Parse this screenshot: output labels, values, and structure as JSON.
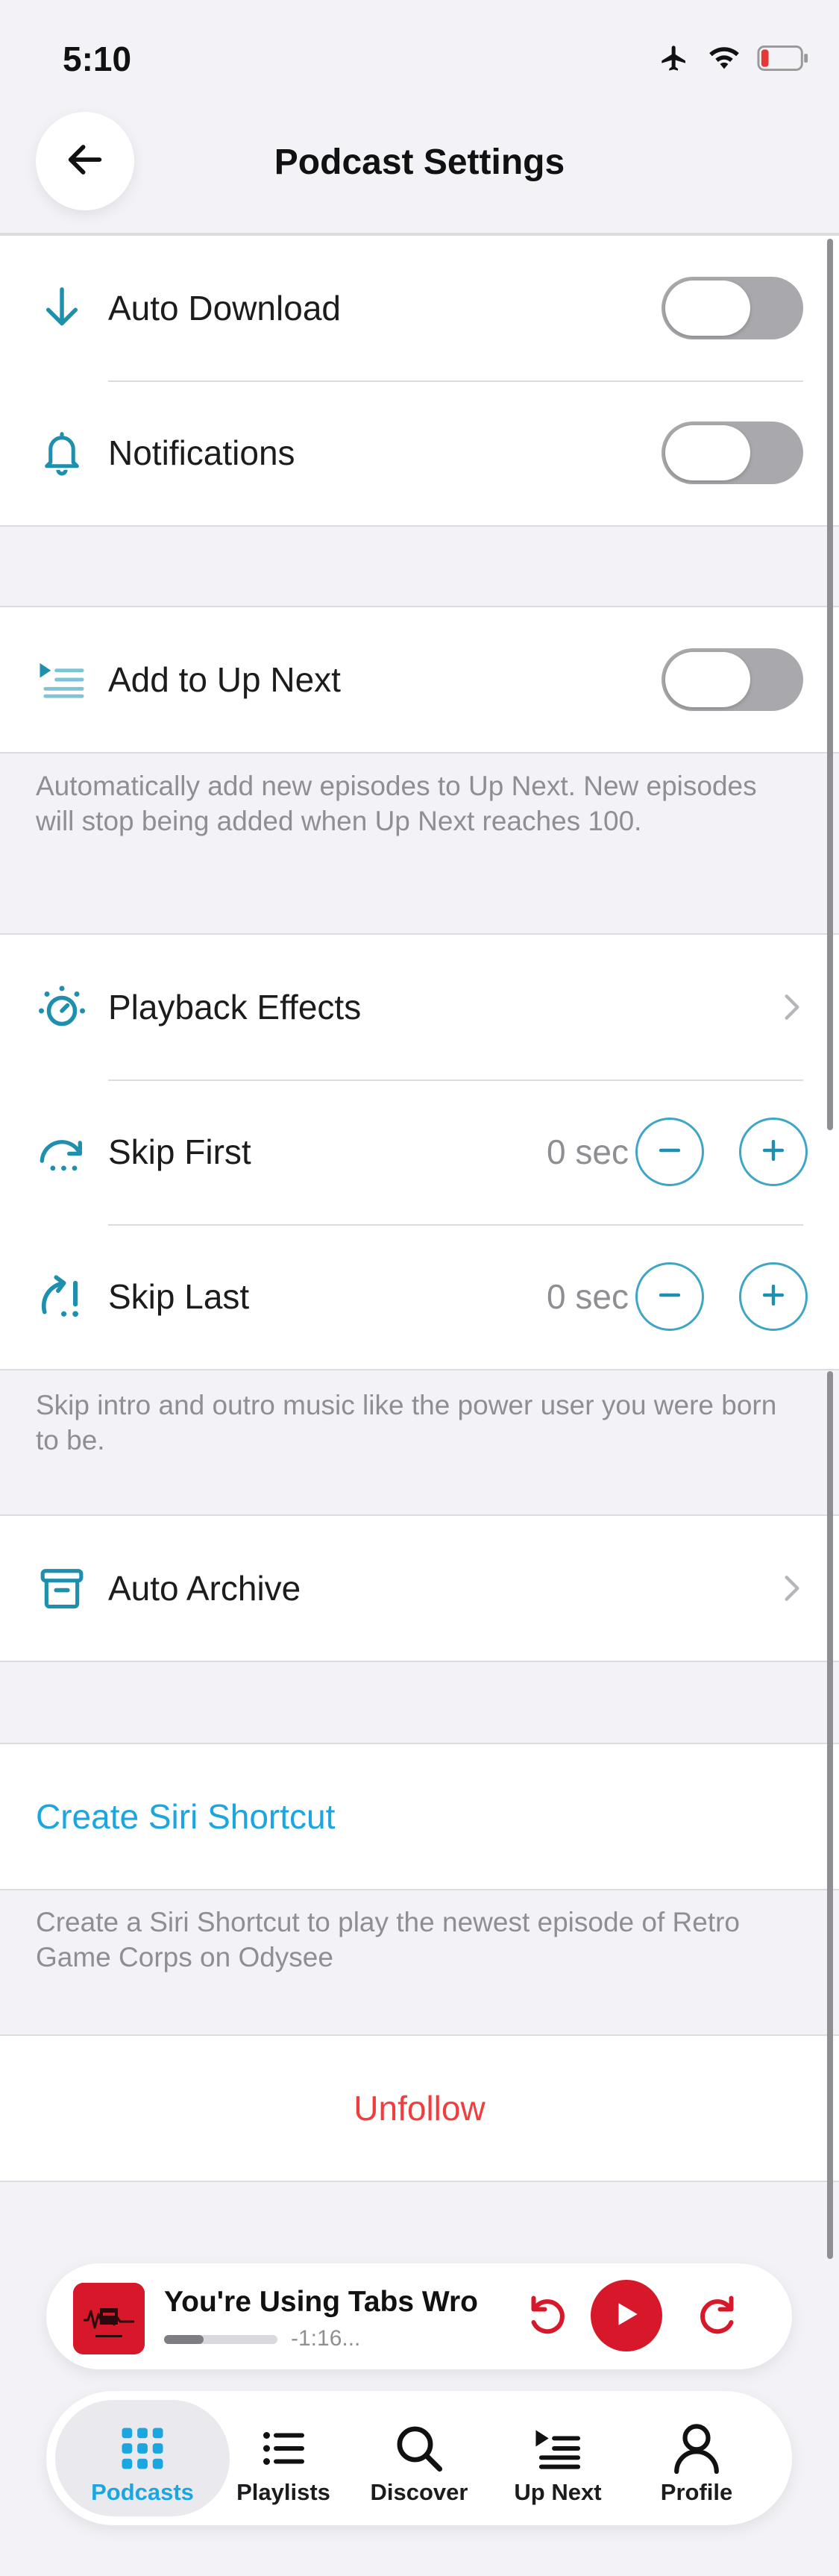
{
  "status_bar": {
    "time": "5:10"
  },
  "nav": {
    "title": "Podcast Settings"
  },
  "settings": {
    "auto_download": {
      "label": "Auto Download",
      "enabled": false
    },
    "notifications": {
      "label": "Notifications",
      "enabled": false
    },
    "add_to_up_next": {
      "label": "Add to Up Next",
      "enabled": false
    },
    "up_next_footer": "Automatically add new episodes to Up Next. New episodes will stop being added when Up Next reaches 100.",
    "playback_effects": {
      "label": "Playback Effects"
    },
    "skip_first": {
      "label": "Skip First",
      "value": "0 sec"
    },
    "skip_last": {
      "label": "Skip Last",
      "value": "0 sec"
    },
    "skip_footer": "Skip intro and outro music like the power user you were born to be.",
    "auto_archive": {
      "label": "Auto Archive"
    },
    "siri_shortcut": {
      "label": "Create Siri Shortcut"
    },
    "siri_footer": "Create a Siri Shortcut to play the newest episode of Retro Game Corps on Odysee",
    "unfollow": {
      "label": "Unfollow"
    }
  },
  "mini_player": {
    "title": "You're Using Tabs Wrong",
    "time_remaining": "-1:16...",
    "progress": 0.35
  },
  "tab_bar": {
    "tabs": [
      {
        "label": "Podcasts",
        "active": true
      },
      {
        "label": "Playlists",
        "active": false
      },
      {
        "label": "Discover",
        "active": false
      },
      {
        "label": "Up Next",
        "active": false
      },
      {
        "label": "Profile",
        "active": false
      }
    ]
  },
  "colors": {
    "accent": "#1ba6e0",
    "icon_teal": "#1f8fae",
    "destructive": "#f03e3e",
    "brand_red": "#d7182a"
  }
}
